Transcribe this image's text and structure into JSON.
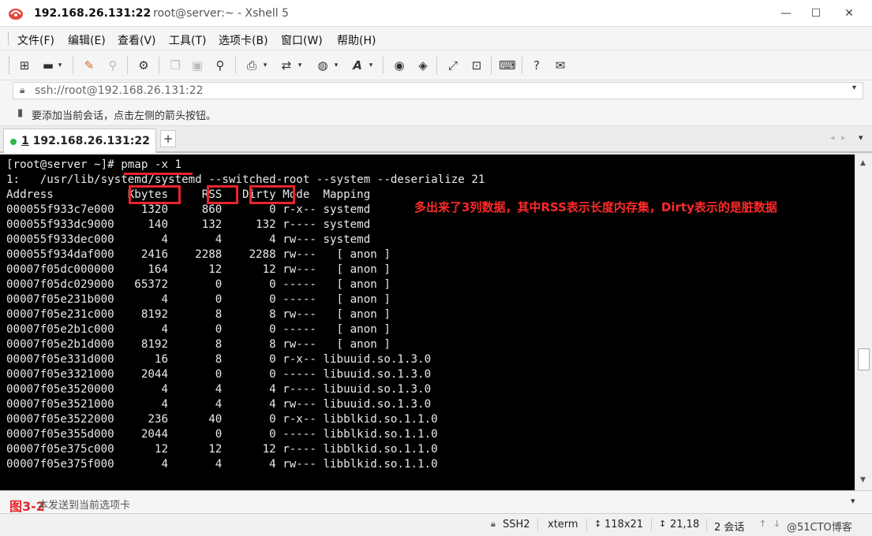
{
  "window": {
    "title_ip": "192.168.26.131:22",
    "title_rest": "root@server:~ - Xshell 5",
    "minimize": "—",
    "maximize": "☐",
    "close": "✕"
  },
  "menu": {
    "items": [
      "文件(F)",
      "编辑(E)",
      "查看(V)",
      "工具(T)",
      "选项卡(B)",
      "窗口(W)",
      "帮助(H)"
    ]
  },
  "toolbar": {
    "icons": [
      "new-session-icon",
      "open-folder-icon",
      "pencil-icon",
      "magic-wand-icon",
      "properties-icon",
      "copy-icon",
      "paste-icon",
      "find-icon",
      "print-icon",
      "transfer-icon",
      "globe-icon",
      "font-icon",
      "xftp-icon",
      "xmanager-icon",
      "fullscreen-icon",
      "lock-icon",
      "keyboard-icon",
      "help-icon",
      "chat-icon"
    ]
  },
  "address": {
    "value": "ssh://root@192.168.26.131:22"
  },
  "hint": {
    "text": "要添加当前会话，点击左侧的箭头按钮。"
  },
  "tabs": {
    "active_number": "1",
    "active_label": " 192.168.26.131:22",
    "add": "+"
  },
  "terminal": {
    "lines": [
      "[root@server ~]# pmap -x 1",
      "1:   /usr/lib/systemd/systemd --switched-root --system --deserialize 21",
      "Address           Kbytes     RSS   Dirty Mode  Mapping",
      "000055f933c7e000    1320     860       0 r-x-- systemd",
      "000055f933dc9000     140     132     132 r---- systemd",
      "000055f933dec000       4       4       4 rw--- systemd",
      "000055f934daf000    2416    2288    2288 rw---   [ anon ]",
      "00007f05dc000000     164      12      12 rw---   [ anon ]",
      "00007f05dc029000   65372       0       0 -----   [ anon ]",
      "00007f05e231b000       4       0       0 -----   [ anon ]",
      "00007f05e231c000    8192       8       8 rw---   [ anon ]",
      "00007f05e2b1c000       4       0       0 -----   [ anon ]",
      "00007f05e2b1d000    8192       8       8 rw---   [ anon ]",
      "00007f05e331d000      16       8       0 r-x-- libuuid.so.1.3.0",
      "00007f05e3321000    2044       0       0 ----- libuuid.so.1.3.0",
      "00007f05e3520000       4       4       4 r---- libuuid.so.1.3.0",
      "00007f05e3521000       4       4       4 rw--- libuuid.so.1.3.0",
      "00007f05e3522000     236      40       0 r-x-- libblkid.so.1.1.0",
      "00007f05e355d000    2044       0       0 ----- libblkid.so.1.1.0",
      "00007f05e375c000      12      12      12 r---- libblkid.so.1.1.0",
      "00007f05e375f000       4       4       4 rw--- libblkid.so.1.1.0"
    ],
    "annotation": "多出来了3列数据，其中RSS表示长度内存集，Dirty表示的是脏数据",
    "highlight_color": "#e8252b"
  },
  "compose": {
    "label": "图3-2",
    "text": "本发送到当前选项卡"
  },
  "status": {
    "protocol": "SSH2",
    "term": "xterm",
    "size": "118x21",
    "cursor": "21,18",
    "sessions": "2 会话",
    "watermark": "@51CTO博客"
  }
}
